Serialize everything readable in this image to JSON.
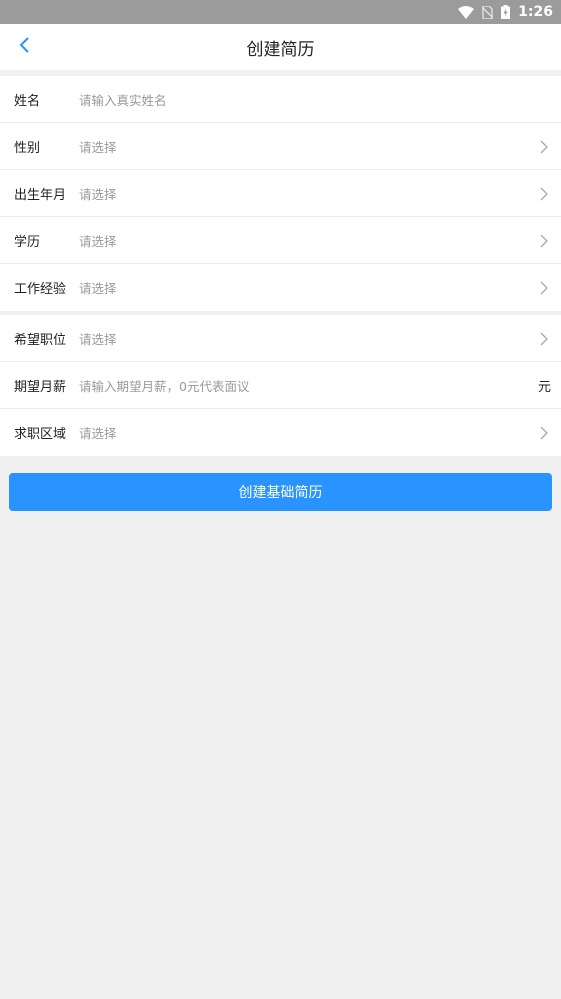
{
  "status_bar": {
    "time": "1:26",
    "icons": [
      "wifi-icon",
      "no-sim-icon",
      "battery-charging-icon"
    ]
  },
  "nav": {
    "title": "创建简历",
    "back_icon": "chevron-left-icon"
  },
  "basic_info": [
    {
      "label": "姓名",
      "value": "请输入真实姓名",
      "type": "input"
    },
    {
      "label": "性别",
      "value": "请选择",
      "type": "select"
    },
    {
      "label": "出生年月",
      "value": "请选择",
      "type": "select"
    },
    {
      "label": "学历",
      "value": "请选择",
      "type": "select"
    },
    {
      "label": "工作经验",
      "value": "请选择",
      "type": "select"
    }
  ],
  "job_intent": [
    {
      "label": "希望职位",
      "value": "请选择",
      "type": "select"
    },
    {
      "label": "期望月薪",
      "value": "请输入期望月薪，0元代表面议",
      "type": "input",
      "unit": "元"
    },
    {
      "label": "求职区域",
      "value": "请选择",
      "type": "select"
    }
  ],
  "submit_label": "创建基础简历",
  "colors": {
    "accent": "#2994ff",
    "status_bar": "#9b9b9b",
    "background": "#f0f0f0"
  }
}
